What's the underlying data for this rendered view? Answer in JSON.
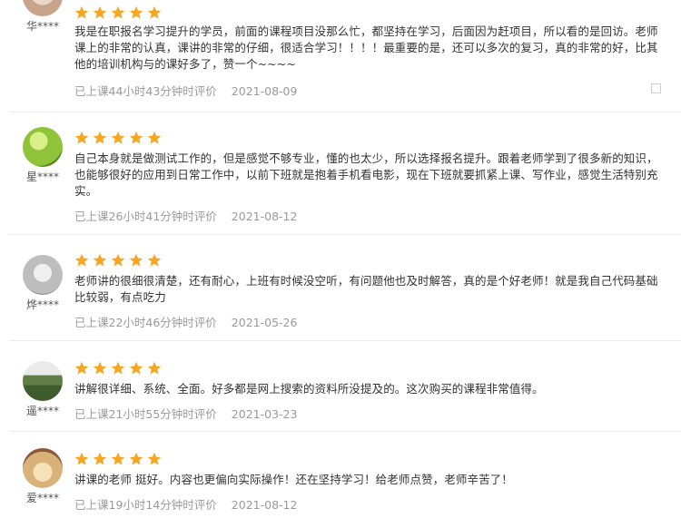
{
  "reviews": [
    {
      "user": "华****",
      "rating": 5,
      "text": "我是在职报名学习提升的学员，前面的课程项目没那么忙，都坚持在学习，后面因为赶项目，所以看的是回访。老师课上的非常的认真，课讲的非常的仔细，很适合学习！！！！最重要的是，还可以多次的复习，真的非常的好，比其他的培训机构与的课好多了，赞一个~~~~",
      "elapsed": "已上课44小时43分钟时评价",
      "date": "2021-08-09",
      "avatar_color": "#c8a48a"
    },
    {
      "user": "星****",
      "rating": 5,
      "text": "自己本身就是做测试工作的，但是感觉不够专业，懂的也太少，所以选择报名提升。跟着老师学到了很多新的知识，也能够很好的应用到日常工作中，以前下班就是抱着手机看电影，现在下班就要抓紧上课、写作业，感觉生活特别充实。",
      "elapsed": "已上课26小时41分钟时评价",
      "date": "2021-08-12",
      "avatar_color": "#8fc43a"
    },
    {
      "user": "烨****",
      "rating": 5,
      "text": "老师讲的很细很清楚，还有耐心，上班有时候没空听，有问题他也及时解答，真的是个好老师！就是我自己代码基础比较弱，有点吃力",
      "elapsed": "已上课22小时46分钟时评价",
      "date": "2021-05-26",
      "avatar_color": "#b9b9b9"
    },
    {
      "user": "遥****",
      "rating": 5,
      "text": "讲解很详细、系统、全面。好多都是网上搜索的资料所没提及的。这次购买的课程非常值得。",
      "elapsed": "已上课21小时55分钟时评价",
      "date": "2021-03-23",
      "avatar_color": "#6f8f55"
    },
    {
      "user": "爱****",
      "rating": 5,
      "text": "讲课的老师 挺好。内容也更偏向实际操作！还在坚持学习！给老师点赞，老师辛苦了！",
      "elapsed": "已上课19小时14分钟时评价",
      "date": "2021-08-12",
      "avatar_color": "#d9b27a"
    }
  ],
  "colors": {
    "star": "#f5a623",
    "meta": "#9a9a9a",
    "divider": "#ececec"
  },
  "icons": {
    "star": "star-icon",
    "side": "expand-icon"
  }
}
